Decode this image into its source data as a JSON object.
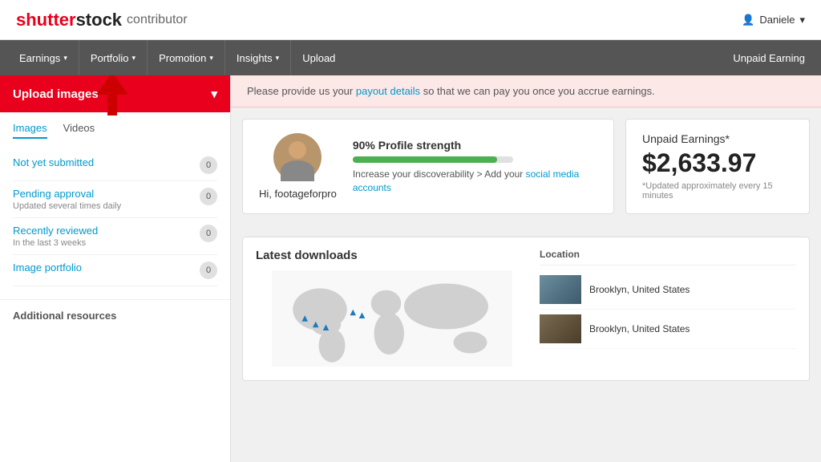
{
  "header": {
    "logo_shutter": "shutter",
    "logo_stock": "stock",
    "logo_contributor": "contributor",
    "user_name": "Daniele",
    "user_icon": "▾"
  },
  "nav": {
    "items": [
      {
        "label": "Earnings",
        "has_dropdown": true
      },
      {
        "label": "Portfolio",
        "has_dropdown": true
      },
      {
        "label": "Promotion",
        "has_dropdown": true
      },
      {
        "label": "Insights",
        "has_dropdown": true
      },
      {
        "label": "Upload",
        "has_dropdown": false
      }
    ],
    "unpaid_earning": "Unpaid Earning"
  },
  "sidebar": {
    "upload_btn": "Upload images",
    "tabs": [
      {
        "label": "Images",
        "active": true
      },
      {
        "label": "Videos",
        "active": false
      }
    ],
    "items": [
      {
        "label": "Not yet submitted",
        "sub": "",
        "count": "0"
      },
      {
        "label": "Pending approval",
        "sub": "Updated several times daily",
        "count": "0"
      },
      {
        "label": "Recently reviewed",
        "sub": "In the last 3 weeks",
        "count": "0"
      },
      {
        "label": "Image portfolio",
        "sub": "",
        "count": "0"
      }
    ],
    "additional": "Additional resources"
  },
  "alert": {
    "text_before": "Please provide us your ",
    "link_text": "payout details",
    "text_after": " so that we can pay you once you accrue earnings."
  },
  "profile": {
    "greeting": "Hi, footageforpro",
    "strength_label": "90% Profile strength",
    "strength_pct": 90,
    "strength_desc_before": "Increase your discoverability > Add your ",
    "strength_link": "social media accounts"
  },
  "earnings": {
    "title": "Unpaid Earnings*",
    "amount": "$2,633.97",
    "note": "*Updated approximately every 15 minutes"
  },
  "downloads": {
    "title": "Latest downloads",
    "list_header": "Location",
    "items": [
      {
        "location": "Brooklyn, United States"
      },
      {
        "location": "Brooklyn, United States"
      }
    ]
  },
  "colors": {
    "red": "#e8001c",
    "blue_link": "#0099cc",
    "nav_bg": "#555555"
  }
}
